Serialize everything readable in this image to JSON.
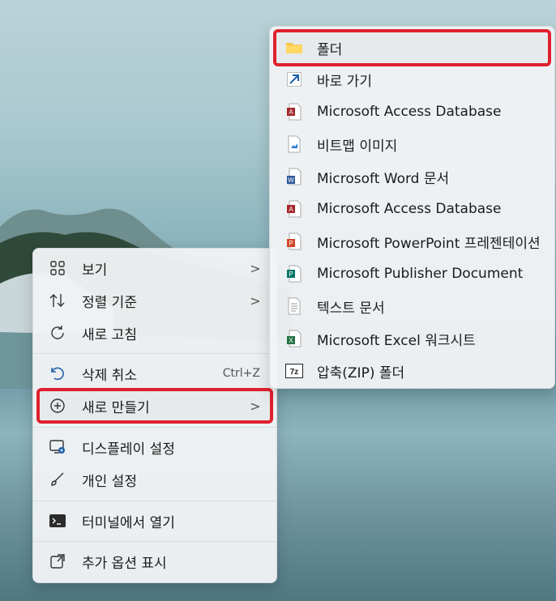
{
  "context_menu": {
    "items": [
      {
        "label": "보기",
        "icon": "grid-icon"
      },
      {
        "label": "정렬 기준",
        "icon": "sort-icon"
      },
      {
        "label": "새로 고침",
        "icon": "refresh-icon"
      },
      {
        "label": "삭제 취소",
        "icon": "undo-icon",
        "shortcut": "Ctrl+Z"
      },
      {
        "label": "새로 만들기",
        "icon": "plus-circle-icon"
      },
      {
        "label": "디스플레이 설정",
        "icon": "display-settings-icon"
      },
      {
        "label": "개인 설정",
        "icon": "brush-icon"
      },
      {
        "label": "터미널에서 열기",
        "icon": "terminal-icon"
      },
      {
        "label": "추가 옵션 표시",
        "icon": "external-icon"
      }
    ],
    "chevron": ">"
  },
  "submenu": {
    "items": [
      {
        "label": "폴더",
        "icon": "folder-icon"
      },
      {
        "label": "바로 가기",
        "icon": "shortcut-arrow-icon"
      },
      {
        "label": "Microsoft Access Database",
        "icon": "access-icon"
      },
      {
        "label": "비트맵 이미지",
        "icon": "bitmap-icon"
      },
      {
        "label": "Microsoft Word 문서",
        "icon": "word-icon"
      },
      {
        "label": "Microsoft Access Database",
        "icon": "access-icon"
      },
      {
        "label": "Microsoft PowerPoint 프레젠테이션",
        "icon": "powerpoint-icon"
      },
      {
        "label": "Microsoft Publisher Document",
        "icon": "publisher-icon"
      },
      {
        "label": "텍스트 문서",
        "icon": "text-doc-icon"
      },
      {
        "label": "Microsoft Excel 워크시트",
        "icon": "excel-icon"
      },
      {
        "label": "압축(ZIP) 폴더",
        "icon": "zip-icon"
      }
    ]
  },
  "colors": {
    "highlight": "#e0202e",
    "accent": "#1f5fa8"
  }
}
